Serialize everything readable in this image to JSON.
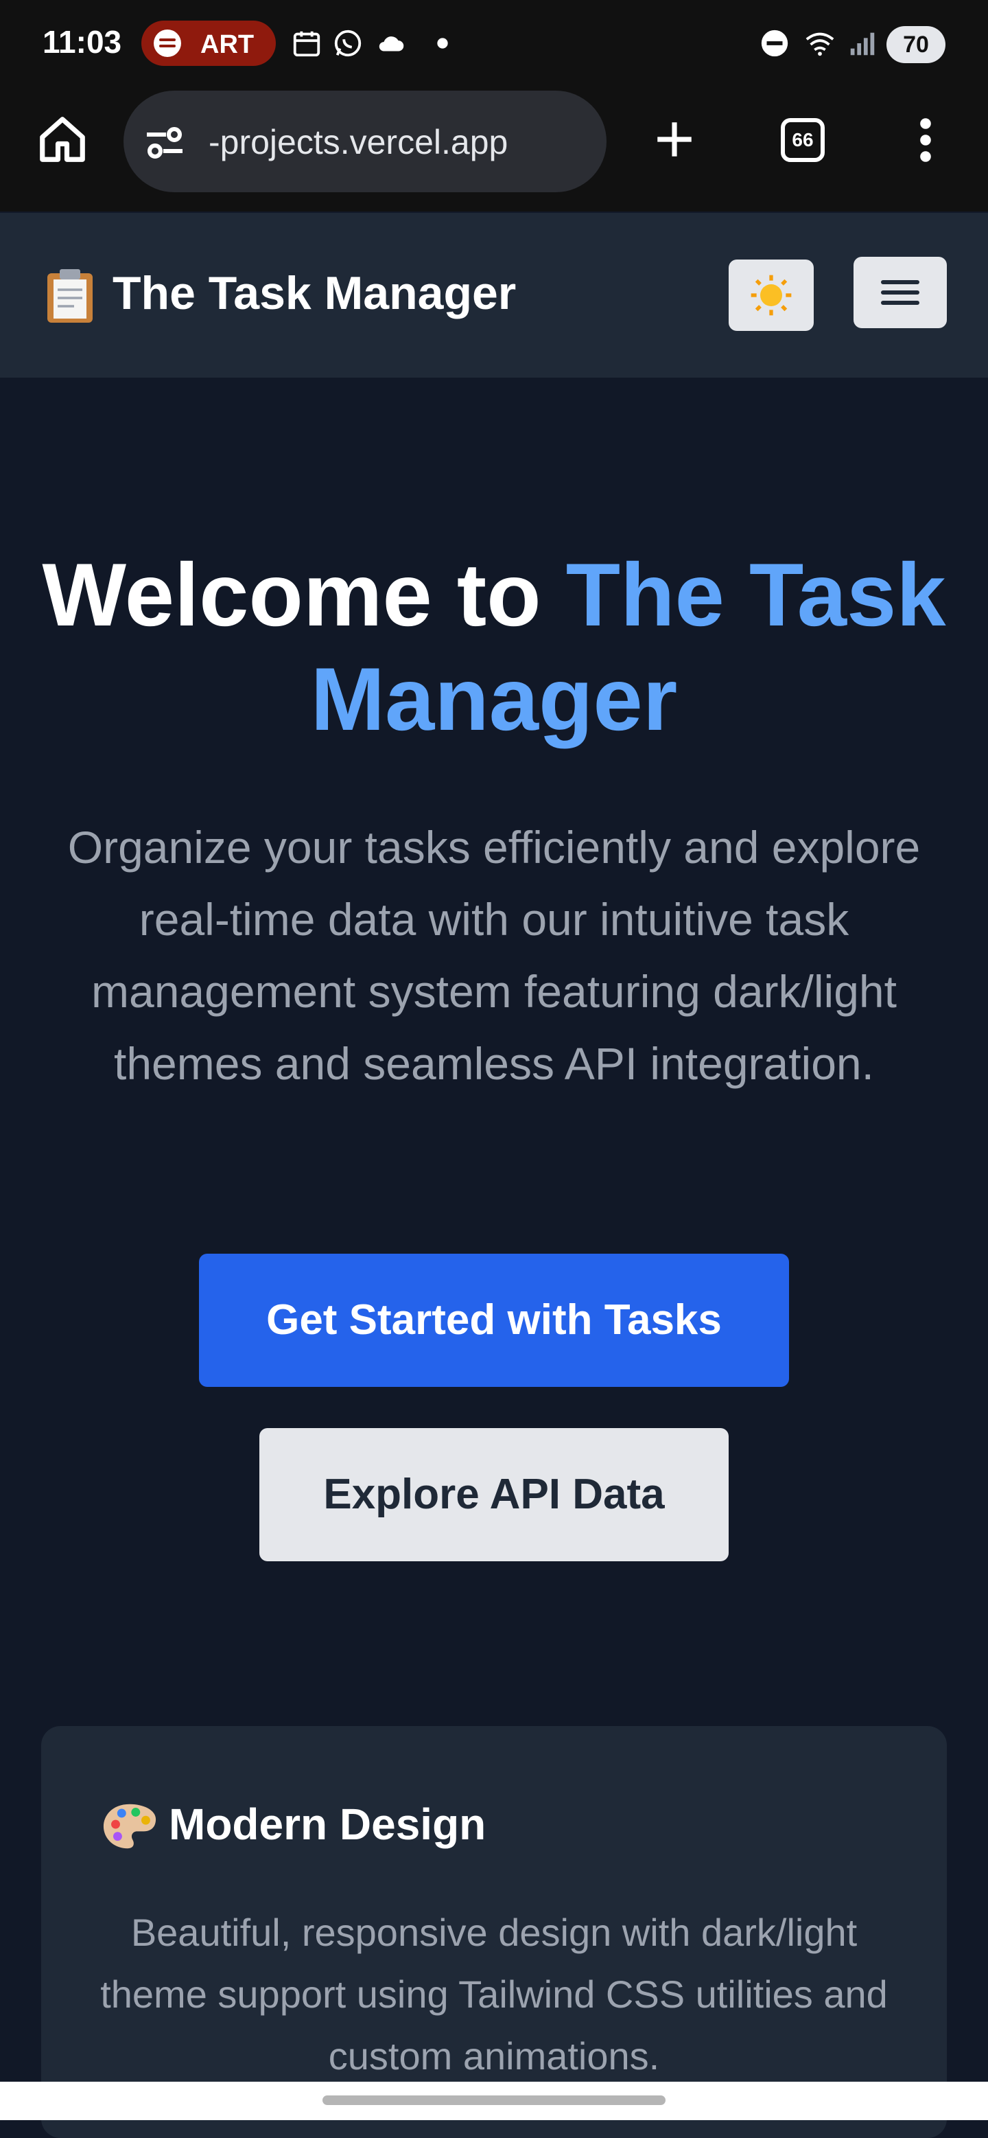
{
  "status_bar": {
    "time": "11:03",
    "media_label": "ART",
    "battery": "70"
  },
  "browser": {
    "url": "-projects.vercel.app",
    "tab_count": "66"
  },
  "header": {
    "title": "The Task Manager"
  },
  "hero": {
    "title_prefix": "Welcome to",
    "title_accent": "The Task Manager",
    "subtitle": "Organize your tasks efficiently and explore real-time data with our intuitive task management system featuring dark/light themes and seamless API integration.",
    "primary_cta": "Get Started with Tasks",
    "secondary_cta": "Explore API Data"
  },
  "feature_card": {
    "title": "Modern Design",
    "description": "Beautiful, responsive design with dark/light theme support using Tailwind CSS utilities and custom animations."
  },
  "colors": {
    "accent": "#60a5fa",
    "primary_button": "#2563eb",
    "background": "#111827",
    "surface": "#1f2937"
  }
}
